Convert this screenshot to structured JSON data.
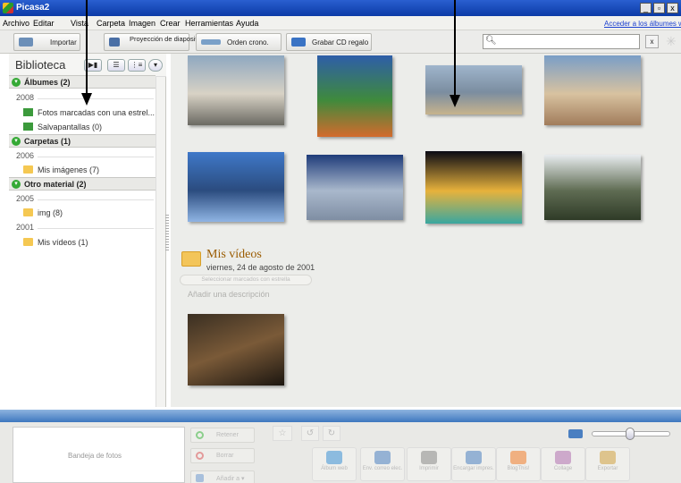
{
  "window": {
    "title": "Picasa2",
    "min": "_",
    "max": "▫",
    "close": "x"
  },
  "menu": {
    "items": [
      "Archivo",
      "Editar",
      "Vista",
      "Carpeta",
      "Imagen",
      "Crear",
      "Herramientas",
      "Ayuda"
    ],
    "account_link": "Acceder a los álbumes w"
  },
  "toolbar": {
    "import_label": "Importar",
    "slideshow_label": "Proyección de diapositivas",
    "timeline_label": "Orden crono.",
    "gift_cd_label": "Grabar CD regalo",
    "search_value": "",
    "clear_label": "x"
  },
  "sidebar": {
    "library_title": "Biblioteca",
    "view_buttons": [
      "▶▮",
      "☰",
      "⋮≡",
      "▾"
    ],
    "sections": [
      {
        "label": "Álbumes (2)",
        "year": "2008",
        "items": [
          "Fotos marcadas con una estrel...",
          "Salvapantallas (0)"
        ]
      },
      {
        "label": "Carpetas (1)",
        "year": "2006",
        "items": [
          "Mis imágenes (7)"
        ]
      },
      {
        "label": "Otro material (2)",
        "years": [
          "2005",
          "2001"
        ],
        "items": [
          "img (8)",
          "Mis vídeos (1)"
        ]
      }
    ]
  },
  "main": {
    "photos": [
      {
        "name": "city-skyline",
        "colors": [
          "#8fa8c0",
          "#6b6a63",
          "#d8d2c5"
        ]
      },
      {
        "name": "mosaic",
        "colors": [
          "#2e5ea8",
          "#d36b2d",
          "#3f8a3c"
        ]
      },
      {
        "name": "harbor",
        "colors": [
          "#9fb5cc",
          "#c7b38d",
          "#7b8da0"
        ]
      },
      {
        "name": "ruins",
        "colors": [
          "#7a9ec7",
          "#a17c5b",
          "#d8c2a0"
        ]
      },
      {
        "name": "cn-tower",
        "colors": [
          "#3f78c8",
          "#8fb4e3",
          "#2b4c7f"
        ]
      },
      {
        "name": "downtown",
        "colors": [
          "#1f3c7a",
          "#7f8ea3",
          "#a9b8cc"
        ]
      },
      {
        "name": "night-lights",
        "colors": [
          "#0a0a14",
          "#3aa7a0",
          "#e7b23c"
        ]
      },
      {
        "name": "pagoda",
        "colors": [
          "#e8ecef",
          "#2f3b27",
          "#5f6c53"
        ]
      }
    ],
    "video_folder": {
      "title": "Mis vídeos",
      "date": "viernes, 24 de agosto de 2001",
      "select_starred": "Seleccionar marcados con estrella",
      "add_description": "Añadir una descripción"
    }
  },
  "bottom": {
    "tray_label": "Bandeja de fotos",
    "retain": "Retener",
    "clear": "Borrar",
    "add_to": "Añadir a  ▾",
    "rotate": [
      "↺",
      "↻"
    ],
    "actions": [
      "Álbum web",
      "Env. correo elec.",
      "Imprimir",
      "Encargar impres.",
      "BlogThis!",
      "Collage",
      "Exportar"
    ],
    "action_colors": [
      "#3a8fd6",
      "#4a7fc1",
      "#888888",
      "#4a7fc1",
      "#f07b2a",
      "#b070b0",
      "#d0a040"
    ]
  }
}
